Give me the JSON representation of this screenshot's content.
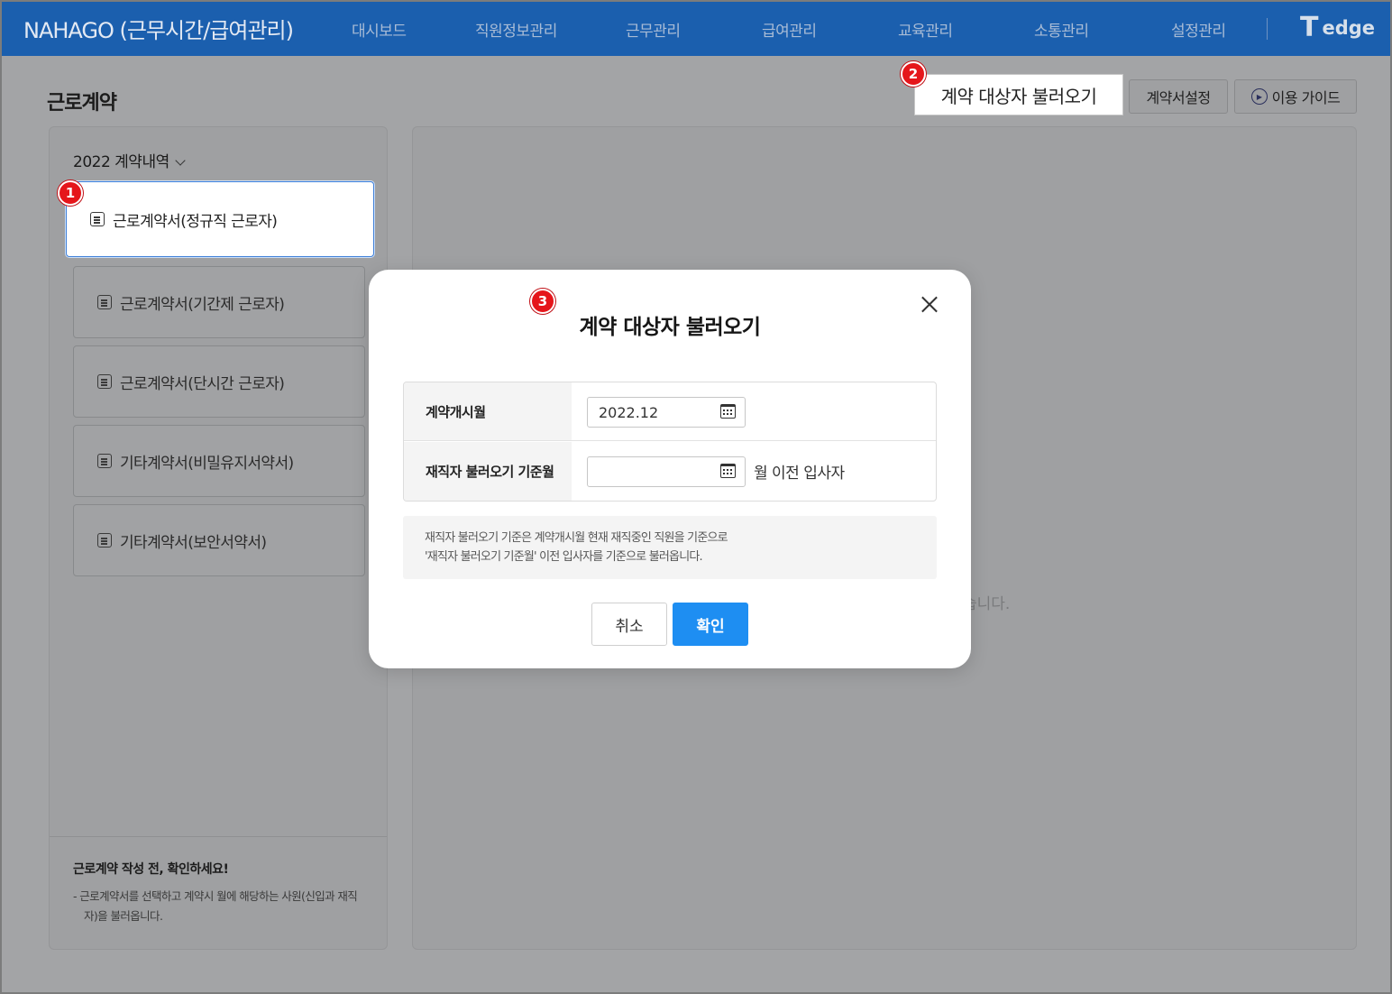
{
  "app": {
    "title": "NAHAGO (근무시간/급여관리)",
    "logo_mark": "T",
    "logo_text": "edge"
  },
  "nav": {
    "items": [
      "대시보드",
      "직원정보관리",
      "근무관리",
      "급여관리",
      "교육관리",
      "소통관리",
      "설정관리"
    ]
  },
  "page": {
    "title": "근로계약",
    "actions": {
      "load_targets": "계약 대상자 불러오기",
      "contract_settings": "계약서설정",
      "guide": "이용 가이드"
    }
  },
  "sidebar": {
    "year_select": "2022 계약내역",
    "contracts": [
      {
        "label": "근로계약서(정규직 근로자)",
        "active": true
      },
      {
        "label": "근로계약서(기간제 근로자)",
        "active": false
      },
      {
        "label": "근로계약서(단시간 근로자)",
        "active": false
      },
      {
        "label": "기타계약서(비밀유지서약서)",
        "active": false
      },
      {
        "label": "기타계약서(보안서약서)",
        "active": false
      }
    ],
    "notice_title": "근로계약 작성 전, 확인하세요!",
    "notice_text": "- 근로계약서를 선택하고 계약시 월에 해당하는 사원(신입과 재직자)을 불러옵니다."
  },
  "main": {
    "hint_fragment": "습니다."
  },
  "modal": {
    "title": "계약 대상자 불러오기",
    "fields": {
      "start_month_label": "계약개시월",
      "start_month_value": "2022.12",
      "base_month_label": "재직자 불러오기 기준월",
      "base_month_value": "",
      "base_month_suffix": "월 이전 입사자"
    },
    "info_line1": "재직자 불러오기 기준은 계약개시월 현재 재직중인 직원을 기준으로",
    "info_line2": "'재직자 불러오기 기준월' 이전 입사자를 기준으로 불러옵니다.",
    "cancel_label": "취소",
    "confirm_label": "확인"
  },
  "badges": [
    "1",
    "2",
    "3"
  ],
  "colors": {
    "header_bg": "#1b5fae",
    "confirm_btn": "#1e8ef2",
    "badge": "#e5161b",
    "active_border": "#3e7fd9"
  },
  "icons": {
    "document": "doc-icon",
    "calendar": "calendar-icon",
    "close": "close-icon",
    "play": "play-circle-icon",
    "dropdown": "chevron-down-icon"
  }
}
